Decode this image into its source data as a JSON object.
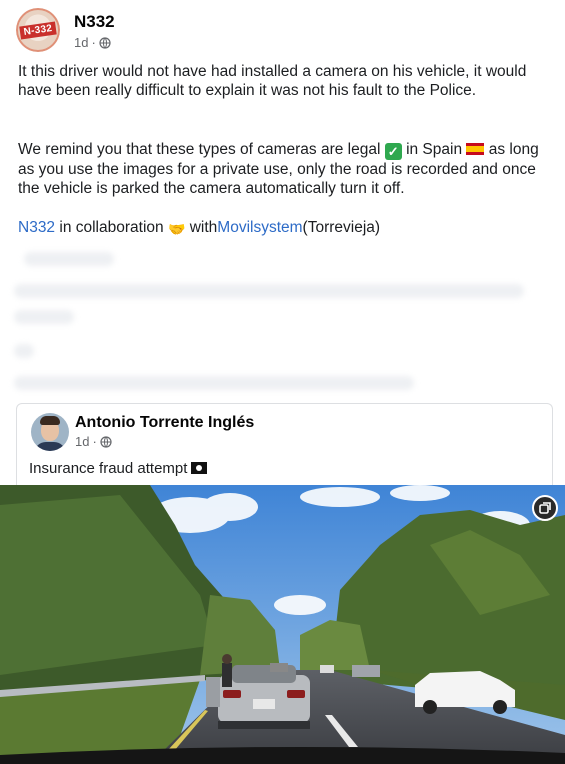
{
  "post": {
    "author": "N332",
    "avatar_plate": "N-332",
    "time": "1d",
    "separator": "·",
    "audience_icon": "globe-icon",
    "p1": "It this driver would not have had installed a camera on his vehicle, it would have been really difficult to explain it was not his fault to the Police.",
    "p2_a": "We remind you that these types of cameras are legal",
    "p2_b": "in Spain",
    "p2_c": "as long as you use the images for a private use, only the road is recorded and once the vehicle is parked the camera automatically turn it off.",
    "p3_author": "N332",
    "p3_mid": "in collaboration",
    "p3_with": "with",
    "p3_partner": "Movilsystem",
    "p3_place": "(Torrevieja)"
  },
  "shared": {
    "author": "Antonio Torrente Inglés",
    "time": "1d",
    "separator": "·",
    "text": "Insurance fraud attempt"
  },
  "icons": {
    "check": "check-mark-emoji",
    "flag": "spain-flag-emoji",
    "handshake": "handshake-emoji",
    "pirate": "pirate-flag-emoji",
    "expand": "expand-icon"
  },
  "colors": {
    "link": "#2d6bc7",
    "meta": "#65676b",
    "text": "#1c1e21"
  }
}
